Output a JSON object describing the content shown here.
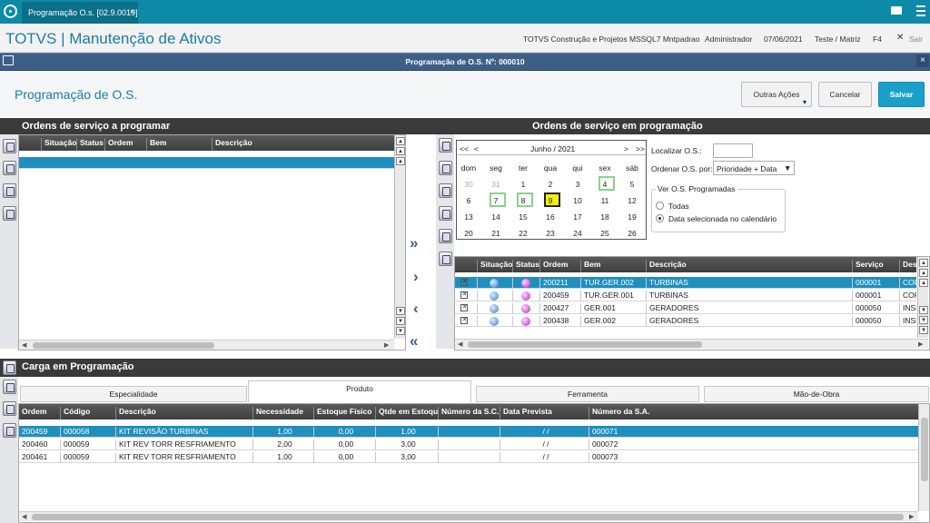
{
  "window": {
    "tab_title": "Programação O.s. [02.9.0019]",
    "tab_close": "×"
  },
  "header": {
    "brand": "TOTVS | Manutenção de Ativos",
    "company": "TOTVS Construção e Projetos MSSQL7 Mntpadrao",
    "user": "Administrador",
    "date": "07/06/2021",
    "branch": "Teste / Matriz",
    "key": "F4",
    "exit": "Sair",
    "exit_icon": "✕"
  },
  "dialog": {
    "title": "Programação de O.S. Nº: 000010",
    "close": "×"
  },
  "page": {
    "title": "Programação de O.S.",
    "outras_acoes": "Outras Ações",
    "dropdown_glyph": "▾",
    "cancelar": "Cancelar",
    "salvar": "Salvar"
  },
  "left": {
    "title": "Ordens de serviço a programar",
    "columns": [
      "Situação",
      "Status",
      "Ordem",
      "Bem",
      "Descrição"
    ]
  },
  "right": {
    "title": "Ordens de serviço em programação",
    "calendar": {
      "month": "Junho / 2021",
      "prev_year": "<<",
      "prev": "<",
      "next": ">",
      "next_year": ">>",
      "weekdays": [
        "dom",
        "seg",
        "ter",
        "qua",
        "qui",
        "sex",
        "sáb"
      ],
      "weeks": [
        [
          "30",
          "31",
          "1",
          "2",
          "3",
          "4",
          "5"
        ],
        [
          "6",
          "7",
          "8",
          "9",
          "10",
          "11",
          "12"
        ],
        [
          "13",
          "14",
          "15",
          "16",
          "17",
          "18",
          "19"
        ],
        [
          "20",
          "21",
          "22",
          "23",
          "24",
          "25",
          "26"
        ]
      ]
    },
    "localizar_label": "Localizar O.S.:",
    "ordenar_label": "Ordenar O.S. por:",
    "ordenar_value": "Prioridade + Data",
    "ordenar_glyph": "▼",
    "ver_group": "Ver O.S. Programadas",
    "opt_todas": "Todas",
    "opt_data": "Data selecionada no calendário",
    "columns": [
      "Situação",
      "Status",
      "Ordem",
      "Bem",
      "Descrição",
      "Serviço",
      "Des"
    ],
    "rows": [
      {
        "ordem": "200211",
        "bem": "TUR.GER.002",
        "descricao": "TURBINAS",
        "servico": "000001",
        "des": "COR"
      },
      {
        "ordem": "200459",
        "bem": "TUR.GER.001",
        "descricao": "TURBINAS",
        "servico": "000001",
        "des": "COR"
      },
      {
        "ordem": "200427",
        "bem": "GER.001",
        "descricao": "GERADORES",
        "servico": "000050",
        "des": "INSP"
      },
      {
        "ordem": "200438",
        "bem": "GER.002",
        "descricao": "GERADORES",
        "servico": "000050",
        "des": "INSP"
      }
    ]
  },
  "carga": {
    "title": "Carga em Programação",
    "tabs": [
      "Especialidade",
      "Produto",
      "Ferramenta",
      "Mão-de-Obra"
    ],
    "columns": [
      "Ordem",
      "Código",
      "Descrição",
      "Necessidade",
      "Estoque Físico",
      "Qtde em Estoque",
      "Número da S.C.",
      "Data Prevista",
      "Número da S.A."
    ],
    "rows": [
      {
        "ordem": "200459",
        "codigo": "000058",
        "descricao": "KIT REVISÃO TURBINAS",
        "nec": "1,00",
        "est": "0,00",
        "qtde": "1,00",
        "sc": "",
        "data": "/ /",
        "sa": "000071"
      },
      {
        "ordem": "200460",
        "codigo": "000059",
        "descricao": "KIT REV TORR RESFRIAMENTO",
        "nec": "2,00",
        "est": "0,00",
        "qtde": "3,00",
        "sc": "",
        "data": "/ /",
        "sa": "000072"
      },
      {
        "ordem": "200461",
        "codigo": "000059",
        "descricao": "KIT REV TORR RESFRIAMENTO",
        "nec": "1,00",
        "est": "0,00",
        "qtde": "3,00",
        "sc": "",
        "data": "/ /",
        "sa": "000073"
      }
    ]
  },
  "colors": {
    "accent": "#1aa0c8",
    "dialog_bar": "#3d5f86",
    "selected_row": "#1f8fbf"
  }
}
